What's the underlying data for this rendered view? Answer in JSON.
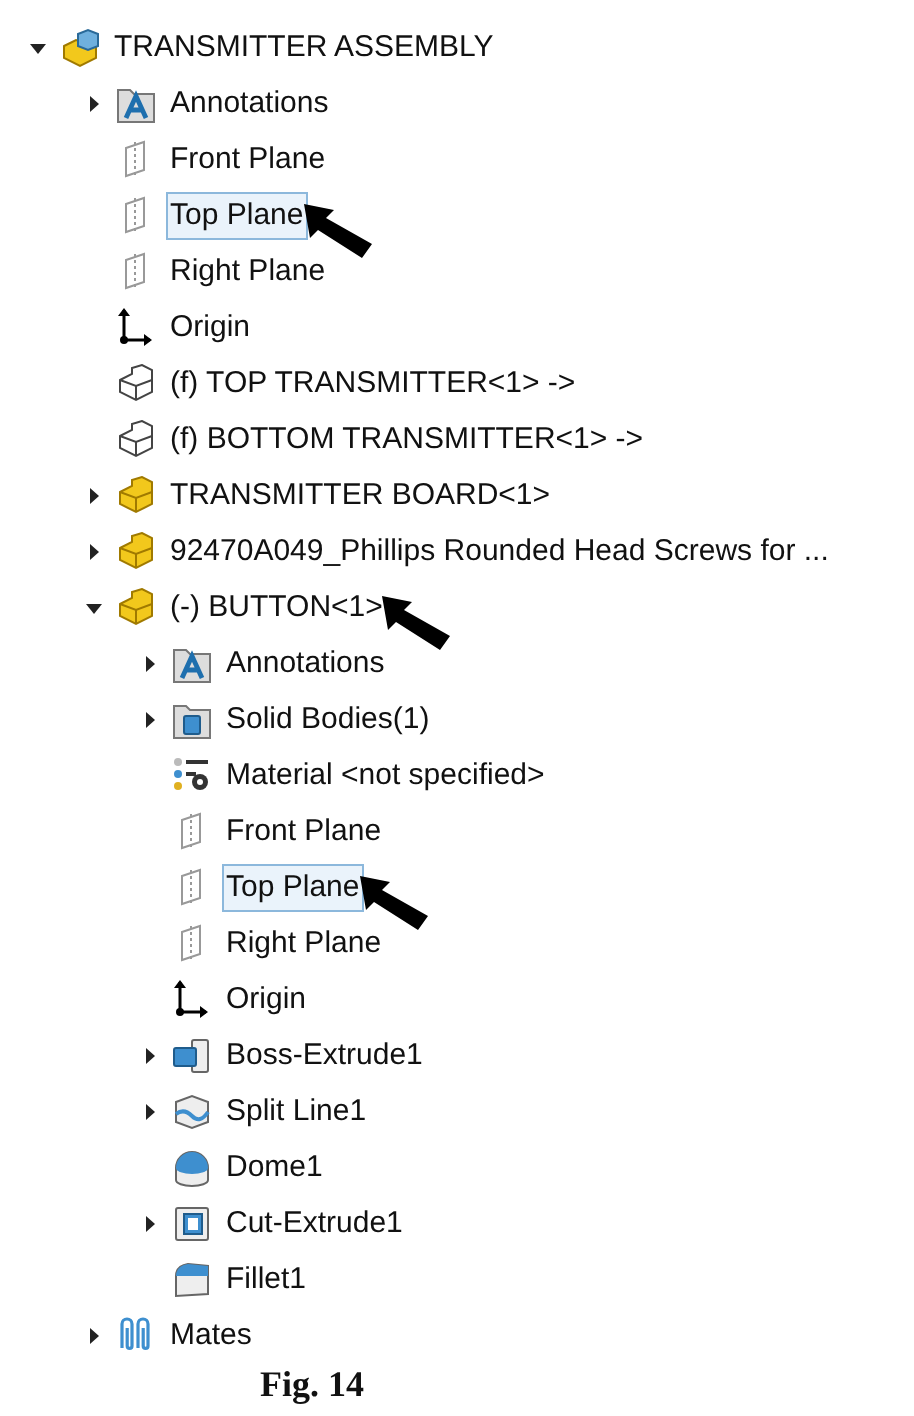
{
  "tree": [
    {
      "label": "TRANSMITTER ASSEMBLY",
      "kind": "assembly",
      "expanded": true,
      "selected": false,
      "pointer": false,
      "children": [
        {
          "label": "Annotations",
          "kind": "annotations",
          "expanded": false,
          "selected": false,
          "pointer": false
        },
        {
          "label": "Front Plane",
          "kind": "plane",
          "selected": false,
          "pointer": false
        },
        {
          "label": "Top Plane",
          "kind": "plane",
          "selected": true,
          "pointer": true
        },
        {
          "label": "Right Plane",
          "kind": "plane",
          "selected": false,
          "pointer": false
        },
        {
          "label": "Origin",
          "kind": "origin",
          "selected": false,
          "pointer": false
        },
        {
          "label": "(f) TOP TRANSMITTER<1> ->",
          "kind": "part-outline",
          "selected": false,
          "pointer": false
        },
        {
          "label": "(f) BOTTOM TRANSMITTER<1> ->",
          "kind": "part-outline",
          "selected": false,
          "pointer": false
        },
        {
          "label": "TRANSMITTER BOARD<1>",
          "kind": "part",
          "expanded": false,
          "selected": false,
          "pointer": false
        },
        {
          "label": "92470A049_Phillips Rounded Head Screws for ...",
          "kind": "part",
          "expanded": false,
          "selected": false,
          "pointer": false
        },
        {
          "label": "(-) BUTTON<1>",
          "kind": "part",
          "expanded": true,
          "selected": false,
          "pointer": true,
          "children": [
            {
              "label": "Annotations",
              "kind": "annotations",
              "expanded": false,
              "selected": false,
              "pointer": false
            },
            {
              "label": "Solid Bodies(1)",
              "kind": "solid-bodies",
              "expanded": false,
              "selected": false,
              "pointer": false
            },
            {
              "label": "Material <not specified>",
              "kind": "material",
              "selected": false,
              "pointer": false
            },
            {
              "label": "Front Plane",
              "kind": "plane",
              "selected": false,
              "pointer": false
            },
            {
              "label": "Top Plane",
              "kind": "plane",
              "selected": true,
              "pointer": true
            },
            {
              "label": "Right Plane",
              "kind": "plane",
              "selected": false,
              "pointer": false
            },
            {
              "label": "Origin",
              "kind": "origin",
              "selected": false,
              "pointer": false
            },
            {
              "label": "Boss-Extrude1",
              "kind": "boss-extrude",
              "expanded": false,
              "selected": false,
              "pointer": false
            },
            {
              "label": "Split Line1",
              "kind": "split-line",
              "expanded": false,
              "selected": false,
              "pointer": false
            },
            {
              "label": "Dome1",
              "kind": "dome",
              "selected": false,
              "pointer": false
            },
            {
              "label": "Cut-Extrude1",
              "kind": "cut-extrude",
              "expanded": false,
              "selected": false,
              "pointer": false
            },
            {
              "label": "Fillet1",
              "kind": "fillet",
              "selected": false,
              "pointer": false
            }
          ]
        },
        {
          "label": "Mates",
          "kind": "mates",
          "expanded": false,
          "selected": false,
          "pointer": false
        }
      ]
    }
  ],
  "caption": "Fig. 14"
}
